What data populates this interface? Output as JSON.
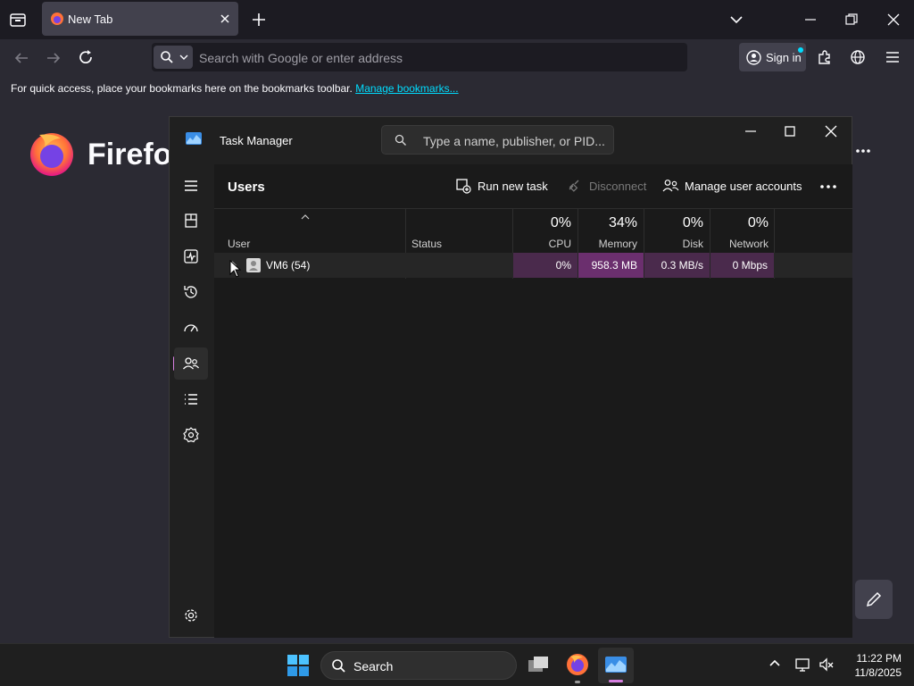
{
  "browser": {
    "tab_title": "New Tab",
    "url_placeholder": "Search with Google or enter address",
    "sign_in_label": "Sign in",
    "bookmarks_text": "For quick access, place your bookmarks here on the bookmarks toolbar.",
    "bookmarks_link": "Manage bookmarks...",
    "brand_text": "Firefox"
  },
  "task_manager": {
    "title": "Task Manager",
    "search_placeholder": "Type a name, publisher, or PID...",
    "page_title": "Users",
    "commands": {
      "run_new_task": "Run new task",
      "disconnect": "Disconnect",
      "manage_user_accounts": "Manage user accounts"
    },
    "columns": {
      "user": "User",
      "status": "Status",
      "cpu": {
        "pct": "0%",
        "label": "CPU"
      },
      "memory": {
        "pct": "34%",
        "label": "Memory"
      },
      "disk": {
        "pct": "0%",
        "label": "Disk"
      },
      "network": {
        "pct": "0%",
        "label": "Network"
      }
    },
    "rows": [
      {
        "user": "VM6 (54)",
        "status": "",
        "cpu": "0%",
        "memory": "958.3 MB",
        "disk": "0.3 MB/s",
        "network": "0 Mbps"
      }
    ],
    "nav_items": [
      "hamburger-menu",
      "processes",
      "performance",
      "app-history",
      "startup-apps",
      "users",
      "details",
      "services"
    ],
    "colors": {
      "cpu_cell": "#4a2a4c",
      "memory_cell": "#6b2f6e",
      "disk_cell": "#4a2a4c",
      "network_cell": "#4a2a4c",
      "accent": "#d67fe0"
    }
  },
  "taskbar": {
    "search_label": "Search",
    "time": "11:22 PM",
    "date": "11/8/2025"
  }
}
